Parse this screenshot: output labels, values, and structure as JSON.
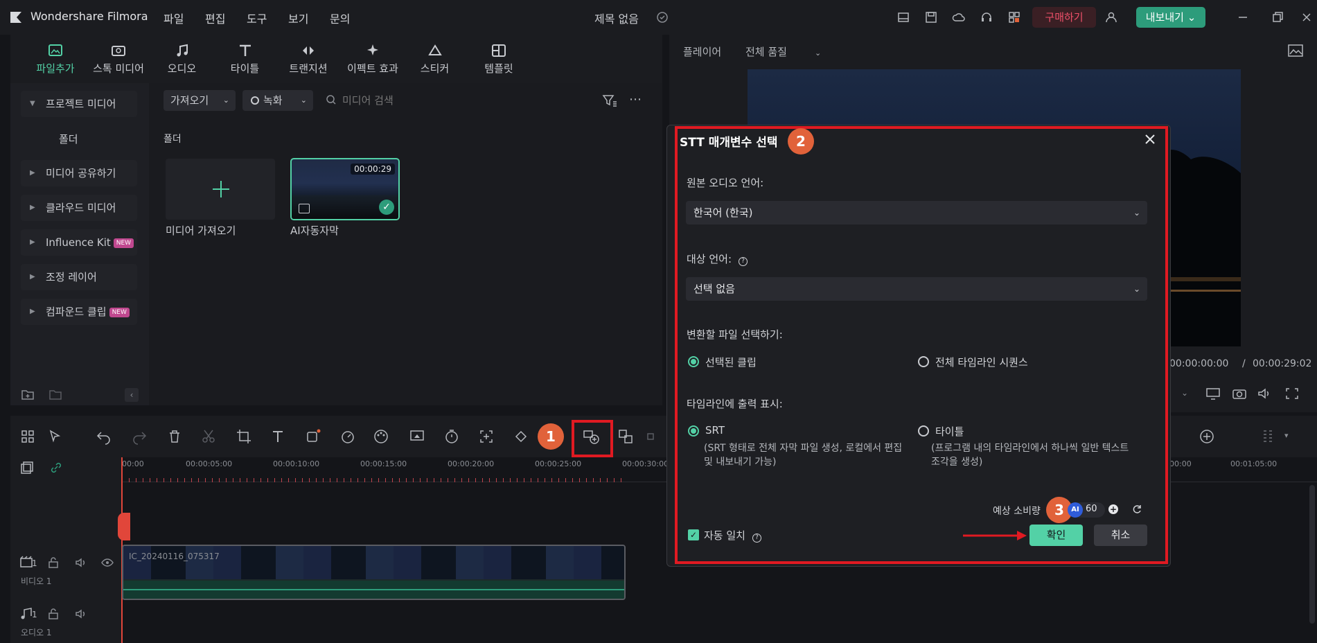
{
  "app": {
    "name": "Wondershare Filmora",
    "menu": [
      "파일",
      "편집",
      "도구",
      "보기",
      "문의"
    ],
    "document_title": "제목 없음",
    "buy_label": "구매하기",
    "export_label": "내보내기"
  },
  "toolbar": {
    "tabs": [
      "파일추가",
      "스톡 미디어",
      "오디오",
      "타이틀",
      "트랜지션",
      "이펙트 효과",
      "스티커",
      "템플릿"
    ]
  },
  "media": {
    "nav": [
      {
        "label": "프로젝트 미디어",
        "badge": ""
      },
      {
        "label": "폴더",
        "badge": ""
      },
      {
        "label": "미디어 공유하기",
        "badge": ""
      },
      {
        "label": "클라우드 미디어",
        "badge": ""
      },
      {
        "label": "Influence Kit",
        "badge": "NEW"
      },
      {
        "label": "조정 레이어",
        "badge": ""
      },
      {
        "label": "컴파운드 클립",
        "badge": "NEW"
      }
    ],
    "import_label": "가져오기",
    "record_label": "녹화",
    "search_placeholder": "미디어 검색",
    "folder_heading": "폴더",
    "import_tile_label": "미디어 가져오기",
    "clip_name": "AI자동자막",
    "clip_duration": "00:00:29"
  },
  "player": {
    "label": "플레이어",
    "quality": "전체 품질",
    "current_time": "00:00:00:00",
    "separator": "/",
    "total_time": "00:00:29:02"
  },
  "timeline": {
    "ruler": [
      "00:00",
      "00:00:05:00",
      "00:00:10:00",
      "00:00:15:00",
      "00:00:20:00",
      "00:00:25:00",
      "00:00:30:00",
      "00:00",
      "00:01:05:00"
    ],
    "clip_label": "IC_20240116_075317",
    "video_track": "비디오 1",
    "audio_track": "오디오 1",
    "track_num_v": "1",
    "track_num_a": "1"
  },
  "dialog": {
    "title": "STT 매개변수 선택",
    "source_lang_label": "원본 오디오 언어:",
    "source_lang_value": "한국어 (한국)",
    "target_lang_label": "대상 언어:",
    "target_lang_value": "선택 없음",
    "file_select_label": "변환할 파일 선택하기:",
    "option_selected_clip": "선택된 클립",
    "option_whole_timeline": "전체 타임라인 시퀀스",
    "output_label": "타임라인에 출력 표시:",
    "option_srt": "SRT",
    "option_srt_desc": "(SRT 형태로 전체 자막 파일 생성, 로컬에서 편집 및 내보내기 가능)",
    "option_title": "타이틀",
    "option_title_desc": "(프로그램 내의 타임라인에서 하나씩 일반 텍스트 조각을 생성)",
    "cost_label": "예상 소비량",
    "credits": "60",
    "auto_match_label": "자동 일치",
    "ok_label": "확인",
    "cancel_label": "취소"
  },
  "steps": [
    "1",
    "2",
    "3"
  ],
  "colors": {
    "accent": "#53d1a6",
    "highlight": "#e01a22",
    "step": "#e1623a"
  }
}
